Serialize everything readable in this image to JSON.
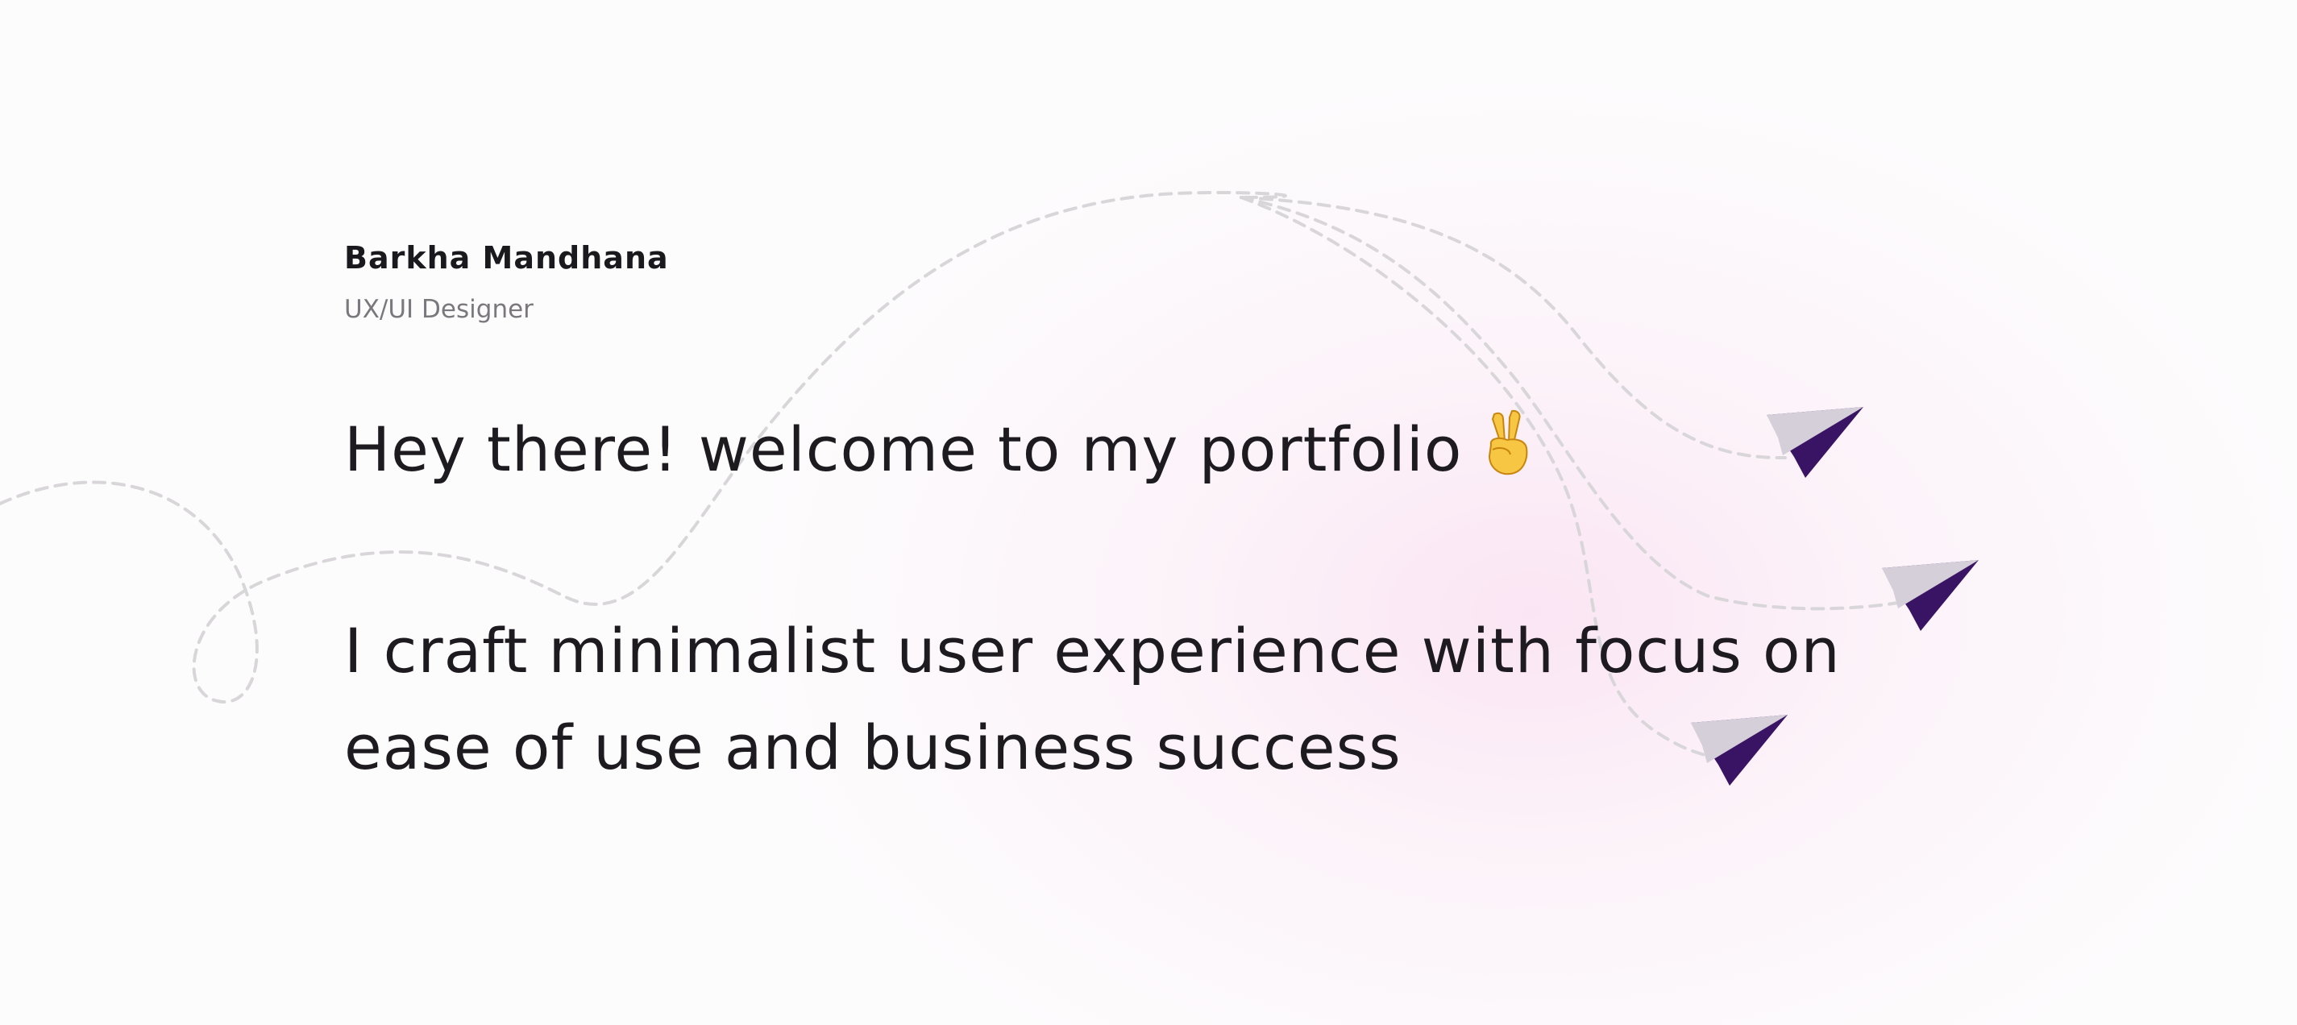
{
  "profile": {
    "name": "Barkha Mandhana",
    "role": "UX/UI Designer"
  },
  "hero": {
    "greeting": "Hey there! welcome to my portfolio",
    "greeting_emoji": "victory-hand-icon",
    "tagline_lines": [
      "I craft minimalist user experience with focus on",
      "ease of use and business success"
    ]
  },
  "decorations": {
    "paper_plane_icons": [
      "paper-plane-icon",
      "paper-plane-icon",
      "paper-plane-icon"
    ],
    "plane_color": "#3a1464",
    "plane_wing_color": "#d4cfd8",
    "trail_color": "#d9d6da",
    "background_glow_color": "#fae1f2"
  }
}
